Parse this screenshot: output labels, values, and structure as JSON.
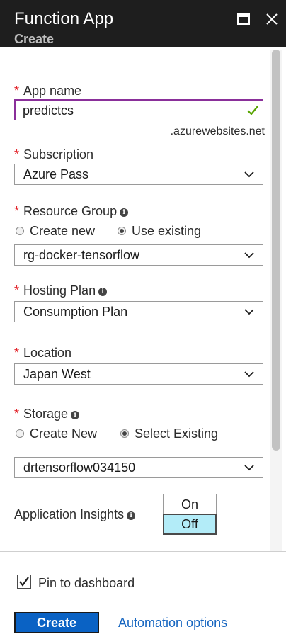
{
  "header": {
    "title": "Function App",
    "subtitle": "Create",
    "maximize_icon": "maximize-icon",
    "close_icon": "close-icon",
    "background": "#1e1e1e"
  },
  "form": {
    "app_name": {
      "label": "App name",
      "value": "predictcs",
      "suffix": ".azurewebsites.net",
      "valid_color": "#57a300"
    },
    "subscription": {
      "label": "Subscription",
      "value": "Azure Pass"
    },
    "resource_group": {
      "label": "Resource Group",
      "options": [
        "Create new",
        "Use existing"
      ],
      "selected_option": "Use existing",
      "value": "rg-docker-tensorflow"
    },
    "hosting_plan": {
      "label": "Hosting Plan",
      "value": "Consumption Plan"
    },
    "location": {
      "label": "Location",
      "value": "Japan West"
    },
    "storage": {
      "label": "Storage",
      "options": [
        "Create New",
        "Select Existing"
      ],
      "selected_option": "Select Existing",
      "value": "drtensorflow034150"
    },
    "application_insights": {
      "label": "Application Insights",
      "on_label": "On",
      "off_label": "Off",
      "selected": "Off",
      "selected_color": "#b3ecf8"
    },
    "required_marker": "*",
    "required_color": "#e3242b"
  },
  "footer": {
    "pin_to_dashboard": {
      "label": "Pin to dashboard",
      "checked": true
    },
    "create_label": "Create",
    "create_color": "#0a62c4",
    "automation_label": "Automation options",
    "link_color": "#1565c0"
  }
}
